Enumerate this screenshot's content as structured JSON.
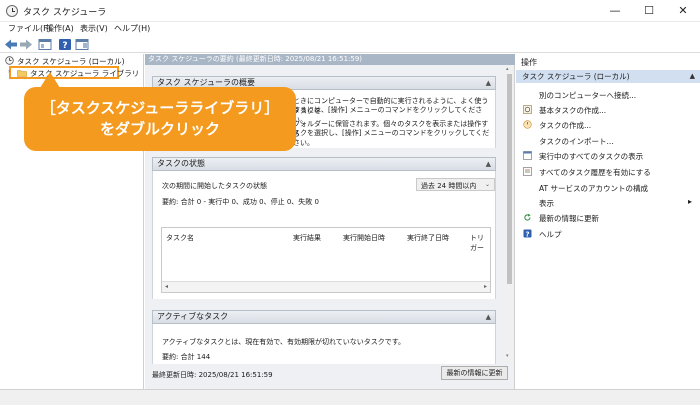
{
  "window": {
    "title": "タスク スケジューラ",
    "minimize": "—",
    "maximize": "☐",
    "close": "✕"
  },
  "menu": [
    "ファイル(F)",
    "操作(A)",
    "表示(V)",
    "ヘルプ(H)"
  ],
  "tree": {
    "root": "タスク スケジューラ (ローカル)",
    "library": "タスク スケジューラ ライブラリ"
  },
  "center": {
    "header": "タスク スケジューラの要約 (最終更新日時: 2025/08/21 16:51:59)",
    "overview": {
      "title": "タスク スケジューラの概要",
      "line1": "ときにコンピューターで自動的に実行されるように、よく使うタスクを",
      "line2": "するには、[操作] メニューのコマンドをクリックしてください。",
      "line3": "フォルダーに保管されます。個々のタスクを表示または操作する",
      "line4": "スクを選択し、[操作] メニューのコマンドをクリックしてください。"
    },
    "status": {
      "title": "タスクの状態",
      "period_label": "次の期間に開始したタスクの状態",
      "period_value": "過去 24 時間以内",
      "summary": "要約: 合計 0 - 実行中 0、成功 0、停止 0、失敗 0",
      "columns": [
        "タスク名",
        "実行結果",
        "実行開始日時",
        "実行終了日時",
        "トリガー"
      ]
    },
    "active": {
      "title": "アクティブなタスク",
      "desc": "アクティブなタスクとは、現在有効で、有効期限が切れていないタスクです。",
      "summary": "要約: 合計 144"
    },
    "footer": {
      "last_updated": "最終更新日時: 2025/08/21 16:51:59",
      "refresh_button": "最新の情報に更新"
    }
  },
  "actions": {
    "title": "操作",
    "section": "タスク スケジューラ (ローカル)",
    "items": [
      {
        "label": "別のコンピューターへ接続...",
        "icon": "none"
      },
      {
        "label": "基本タスクの作成...",
        "icon": "basic-task-icon"
      },
      {
        "label": "タスクの作成...",
        "icon": "create-task-icon"
      },
      {
        "label": "タスクのインポート...",
        "icon": "none"
      },
      {
        "label": "実行中のすべてのタスクの表示",
        "icon": "running-tasks-icon"
      },
      {
        "label": "すべてのタスク履歴を有効にする",
        "icon": "history-icon"
      },
      {
        "label": "AT サービスのアカウントの構成",
        "icon": "none"
      },
      {
        "label": "表示",
        "icon": "none"
      },
      {
        "label": "最新の情報に更新",
        "icon": "refresh-icon"
      },
      {
        "label": "ヘルプ",
        "icon": "help-icon"
      }
    ]
  },
  "callout": {
    "line1": "［タスクスケジューラライブラリ］",
    "line2": "をダブルクリック"
  },
  "colors": {
    "accent_orange": "#f39a1f",
    "header_blue": "#a9b6c6",
    "selected_blue": "#d1dff0"
  }
}
